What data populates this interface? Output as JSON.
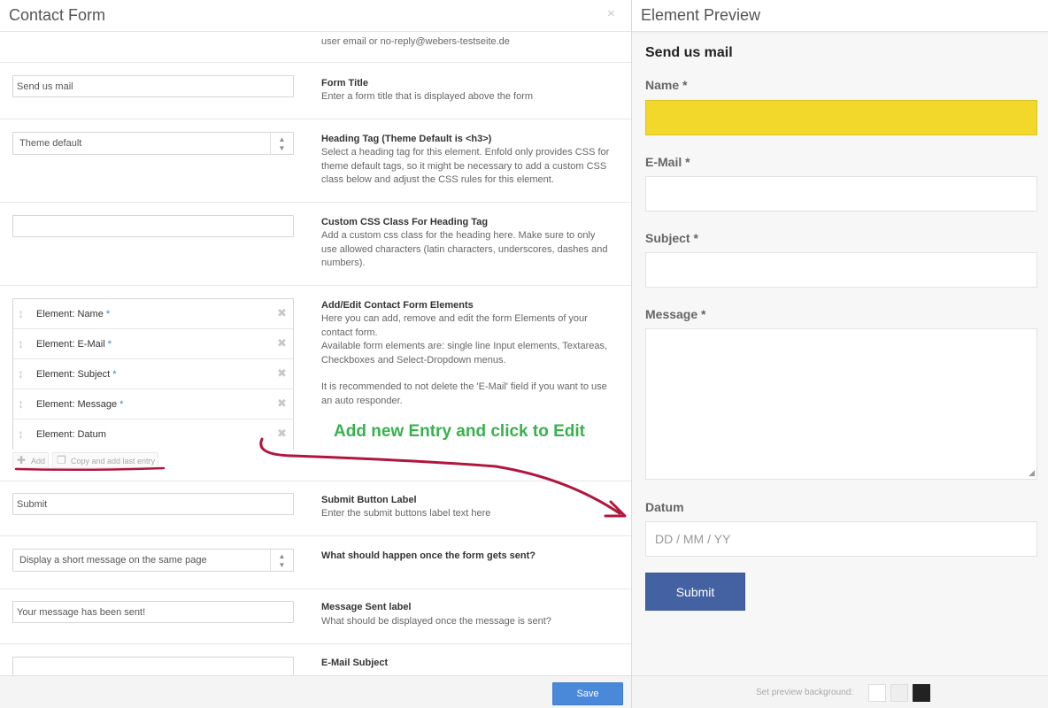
{
  "left_panel": {
    "title": "Contact Form",
    "close_icon": "×",
    "top_fragment": "user email or no-reply@webers-testseite.de",
    "form_title": {
      "value": "Send us mail",
      "label": "Form Title",
      "desc": "Enter a form title that is displayed above the form"
    },
    "heading_tag": {
      "value": "Theme default",
      "label": "Heading Tag (Theme Default is <h3>)",
      "desc": "Select a heading tag for this element. Enfold only provides CSS for theme default tags, so it might be necessary to add a custom CSS class below and adjust the CSS rules for this element."
    },
    "custom_css": {
      "value": "",
      "label": "Custom CSS Class For Heading Tag",
      "desc": "Add a custom css class for the heading here. Make sure to only use allowed characters (latin characters, underscores, dashes and numbers)."
    },
    "form_elements": {
      "label": "Add/Edit Contact Form Elements",
      "desc1": "Here you can add, remove and edit the form Elements of your contact form.",
      "desc2": "Available form elements are: single line Input elements, Textareas, Checkboxes and Select-Dropdown menus.",
      "desc3": "It is recommended to not delete the 'E-Mail' field if you want to use an auto responder.",
      "items": [
        {
          "label": "Element: Name",
          "req": "*"
        },
        {
          "label": "Element: E-Mail",
          "req": "*"
        },
        {
          "label": "Element: Subject",
          "req": "*"
        },
        {
          "label": "Element: Message",
          "req": "*"
        },
        {
          "label": "Element: Datum",
          "req": ""
        }
      ],
      "add_label": "Add",
      "copy_label": "Copy and add last entry"
    },
    "submit_label": {
      "value": "Submit",
      "label": "Submit Button Label",
      "desc": "Enter the submit buttons label text here"
    },
    "on_send": {
      "value": "Display a short message on the same page",
      "label": "What should happen once the form gets sent?"
    },
    "message_sent": {
      "value": "Your message has been sent!",
      "label": "Message Sent label",
      "desc": "What should be displayed once the message is sent?"
    },
    "email_subject": {
      "value": "",
      "label": "E-Mail Subject"
    },
    "save_label": "Save"
  },
  "annotation": {
    "text": "Add new Entry and click to Edit",
    "text_color": "#37b24d",
    "arrow_color": "#b0163e"
  },
  "right_panel": {
    "title": "Element Preview",
    "heading": "Send us mail",
    "fields": {
      "name": {
        "label": "Name",
        "req": "*"
      },
      "email": {
        "label": "E-Mail",
        "req": "*"
      },
      "subject": {
        "label": "Subject",
        "req": "*"
      },
      "message": {
        "label": "Message",
        "req": "*"
      },
      "datum": {
        "label": "Datum",
        "placeholder": "DD / MM / YY"
      }
    },
    "submit": "Submit",
    "bg_label": "Set preview background:",
    "swatches": [
      "#ffffff",
      "#eeeeee",
      "#222222"
    ],
    "accent_colors": {
      "submit": "#4462a2",
      "focus_field": "#f2d82a",
      "save": "#4a88d9"
    }
  }
}
